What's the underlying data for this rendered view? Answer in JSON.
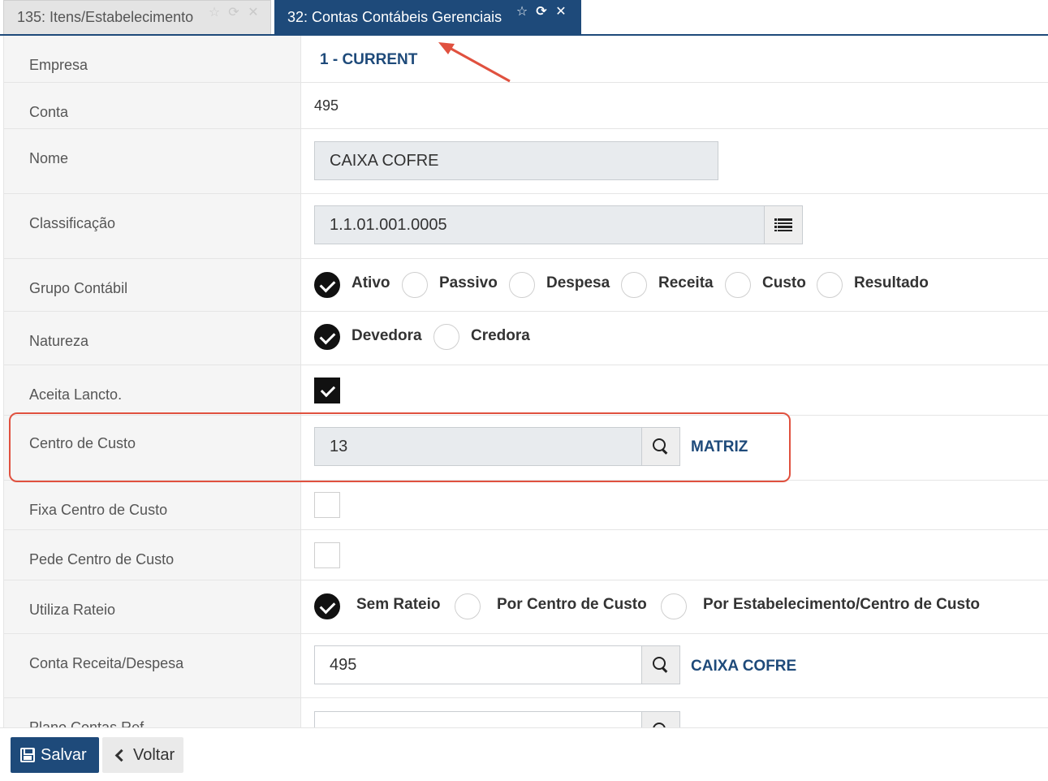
{
  "tabs": [
    {
      "label": "135: Itens/Estabelecimento",
      "active": false
    },
    {
      "label": "32: Contas Contábeis Gerenciais",
      "active": true
    }
  ],
  "tab_icons": [
    "☆",
    "⟳",
    "✕"
  ],
  "form": {
    "empresa": {
      "label": "Empresa",
      "value": "1 - CURRENT"
    },
    "conta": {
      "label": "Conta",
      "value": "495"
    },
    "nome": {
      "label": "Nome",
      "value": "CAIXA COFRE"
    },
    "classificacao": {
      "label": "Classificação",
      "value": "1.1.01.001.0005"
    },
    "grupo": {
      "label": "Grupo Contábil",
      "options": [
        "Ativo",
        "Passivo",
        "Despesa",
        "Receita",
        "Custo",
        "Resultado"
      ],
      "selected": "Ativo"
    },
    "natureza": {
      "label": "Natureza",
      "options": [
        "Devedora",
        "Credora"
      ],
      "selected": "Devedora"
    },
    "aceita": {
      "label": "Aceita Lancto.",
      "checked": true
    },
    "centro_custo": {
      "label": "Centro de Custo",
      "value": "13",
      "description": "MATRIZ"
    },
    "fixa_centro": {
      "label": "Fixa Centro de Custo",
      "checked": false
    },
    "pede_centro": {
      "label": "Pede Centro de Custo",
      "checked": false
    },
    "rateio": {
      "label": "Utiliza Rateio",
      "options": [
        "Sem Rateio",
        "Por Centro de Custo",
        "Por Estabelecimento/Centro de Custo"
      ],
      "selected": "Sem Rateio"
    },
    "conta_receita": {
      "label": "Conta Receita/Despesa",
      "value": "495",
      "description": "CAIXA COFRE"
    },
    "plano_contas": {
      "label": "Plano Contas Ref.",
      "value": ""
    }
  },
  "footer": {
    "save_label": "Salvar",
    "back_label": "Voltar"
  },
  "colors": {
    "primary": "#1e4a7a",
    "annotation": "#e0513f"
  }
}
